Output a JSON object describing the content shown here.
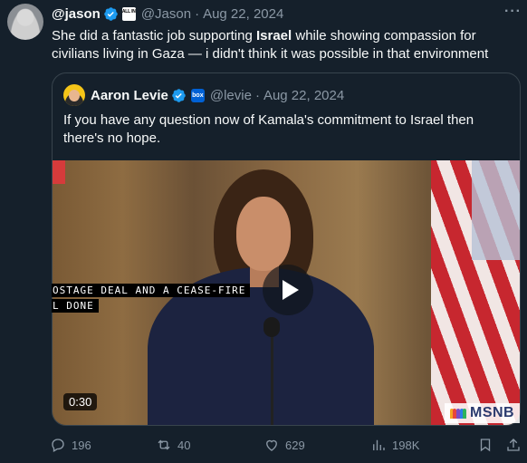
{
  "tweet": {
    "author_name": "@jason",
    "affiliate_badge": "ALL IN",
    "handle": "@Jason",
    "sep": "·",
    "date": "Aug 22, 2024",
    "text_1": "She did a fantastic job supporting ",
    "text_bold": "Israel",
    "text_2": " while showing compassion for civilians living in Gaza — i didn't think it was possible in that environment",
    "more_icon": "more-icon"
  },
  "quote": {
    "author_name": "Aaron Levie",
    "affiliate_badge": "box",
    "handle": "@levie",
    "sep": "·",
    "date": "Aug 22, 2024",
    "text": "If you have any question now of Kamala's commitment to Israel then there's no hope.",
    "video": {
      "caption_line1": "OSTAGE DEAL AND A CEASE-FIRE",
      "caption_line2": "L DONE",
      "duration": "0:30",
      "network": "MSNB"
    }
  },
  "actions": {
    "replies": "196",
    "reposts": "40",
    "likes": "629",
    "views": "198K"
  },
  "colors": {
    "background": "#15202b",
    "text": "#f7f9f9",
    "secondary": "#8b98a5",
    "verified": "#1d9bf0",
    "border": "#38444d"
  }
}
